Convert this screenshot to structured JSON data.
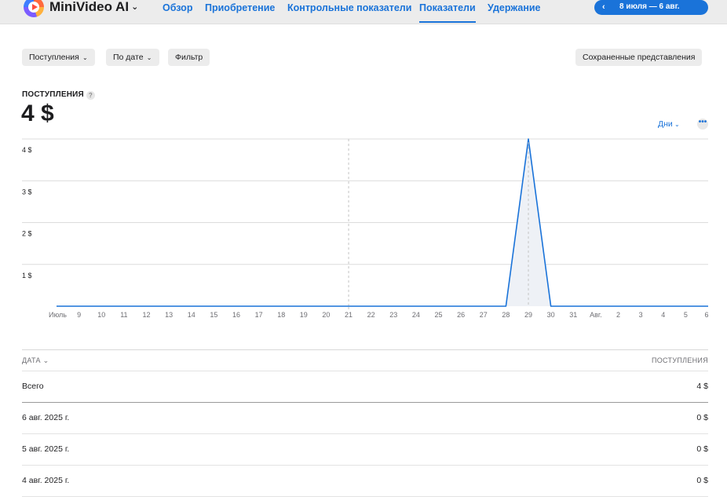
{
  "header": {
    "app_name": "MiniVideo AI",
    "nav": [
      {
        "label": "Обзор",
        "active": false
      },
      {
        "label": "Приобретение",
        "active": false
      },
      {
        "label": "Контрольные показатели",
        "active": false
      },
      {
        "label": "Показатели",
        "active": true
      },
      {
        "label": "Удержание",
        "active": false
      }
    ],
    "date_range": "8 июля — 6 авг."
  },
  "toolbar": {
    "metric_dropdown": "Поступления",
    "sort_dropdown": "По дате",
    "filter": "Фильтр",
    "saved_views": "Сохраненные представления"
  },
  "metric": {
    "label": "ПОСТУПЛЕНИЯ",
    "help": "?",
    "value": "4 $",
    "interval": "Дни",
    "more": "•••"
  },
  "colors": {
    "accent": "#1a73d9",
    "line": "#1a73d9"
  },
  "chart_data": {
    "type": "area",
    "x": [
      "Июль",
      "9",
      "10",
      "11",
      "12",
      "13",
      "14",
      "15",
      "16",
      "17",
      "18",
      "19",
      "20",
      "21",
      "22",
      "23",
      "24",
      "25",
      "26",
      "27",
      "28",
      "29",
      "30",
      "31",
      "Авг.",
      "2",
      "3",
      "4",
      "5",
      "6"
    ],
    "series": [
      {
        "values": [
          0,
          0,
          0,
          0,
          0,
          0,
          0,
          0,
          0,
          0,
          0,
          0,
          0,
          0,
          0,
          0,
          0,
          0,
          0,
          0,
          0,
          4,
          0,
          0,
          0,
          0,
          0,
          0,
          0,
          0
        ]
      }
    ],
    "y_ticks": [
      "1 $",
      "2 $",
      "3 $",
      "4 $"
    ],
    "y_tick_values": [
      1,
      2,
      3,
      4
    ],
    "ylim": [
      0,
      4
    ],
    "marker_labels": [
      "21",
      "29"
    ],
    "grid": true
  },
  "table": {
    "col_date": "ДАТА",
    "col_value": "ПОСТУПЛЕНИЯ",
    "rows": [
      {
        "date": "Всего",
        "value": "4 $"
      },
      {
        "date": "6 авг. 2025 г.",
        "value": "0 $"
      },
      {
        "date": "5 авг. 2025 г.",
        "value": "0 $"
      },
      {
        "date": "4 авг. 2025 г.",
        "value": "0 $"
      }
    ]
  }
}
